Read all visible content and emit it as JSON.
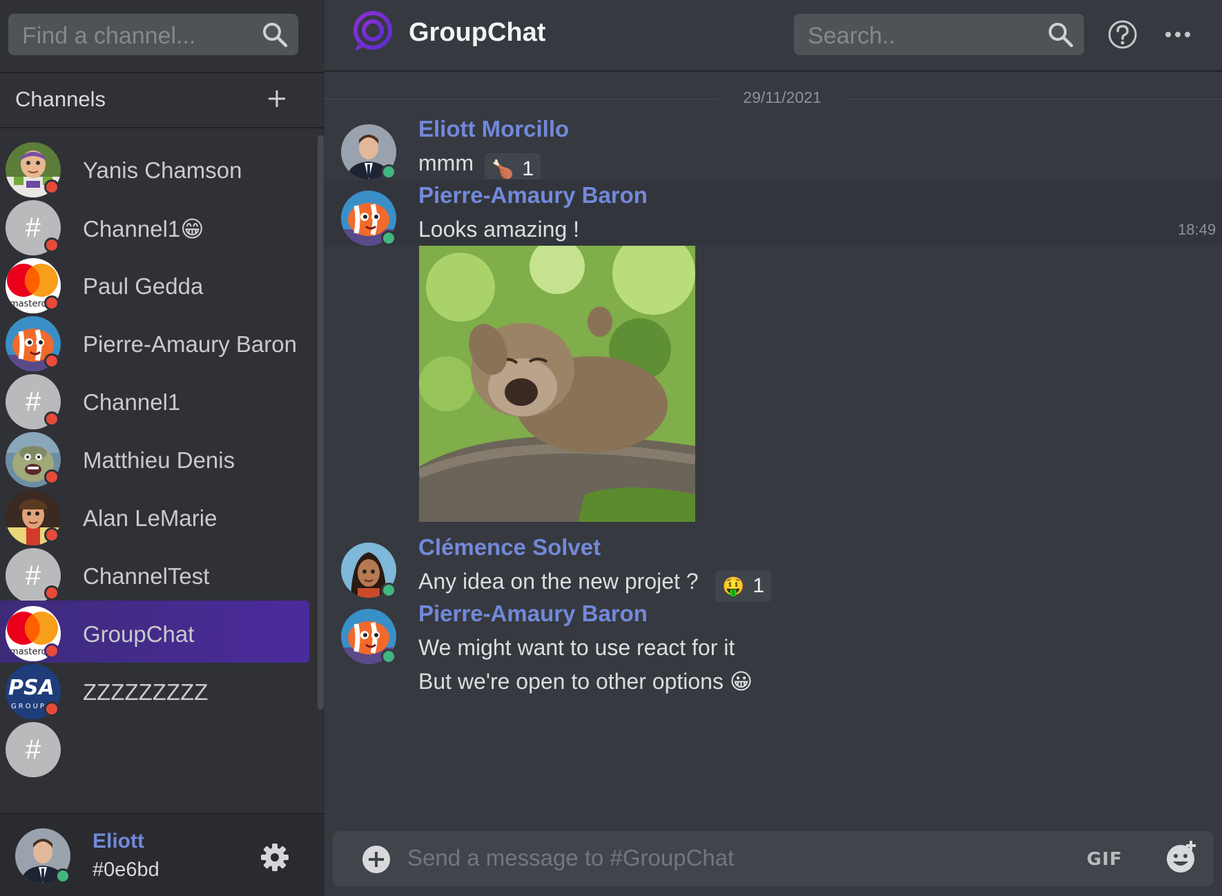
{
  "sidebar": {
    "search_placeholder": "Find a channel...",
    "channels_header": "Channels",
    "channels": [
      {
        "name": "Yanis Chamson",
        "avatar": "buzz-lightyear-avatar",
        "status": "offline"
      },
      {
        "name": "Channel1😁",
        "avatar": "hash",
        "status": "offline"
      },
      {
        "name": "Paul Gedda",
        "avatar": "mastercard-logo",
        "status": "offline"
      },
      {
        "name": "Pierre-Amaury Baron",
        "avatar": "clownfish-avatar",
        "status": "offline"
      },
      {
        "name": "Channel1",
        "avatar": "hash",
        "status": "offline"
      },
      {
        "name": "Matthieu Denis",
        "avatar": "roz-avatar",
        "status": "offline"
      },
      {
        "name": "Alan LeMarie",
        "avatar": "woody-avatar",
        "status": "offline"
      },
      {
        "name": "ChannelTest",
        "avatar": "hash",
        "status": "offline"
      },
      {
        "name": "GroupChat",
        "avatar": "mastercard-logo",
        "status": "offline",
        "active": true
      },
      {
        "name": "ZZZZZZZZZ",
        "avatar": "psa-group-logo",
        "status": "offline"
      },
      {
        "name": "",
        "avatar": "hash",
        "status": "offline"
      }
    ],
    "hash_symbol": "#",
    "mastercard_text": "mastercard",
    "psa_text": "PSA",
    "psa_subtext": "GROUP"
  },
  "user": {
    "name": "Eliott",
    "tag": "#0e6bd"
  },
  "header": {
    "title": "GroupChat",
    "search_placeholder": "Search.."
  },
  "chat": {
    "date": "29/11/2021",
    "messages": [
      {
        "author": "Eliott Morcillo",
        "text": "mmm",
        "reaction_emoji": "🍗",
        "reaction_count": "1"
      },
      {
        "author": "Pierre-Amaury Baron",
        "text": "Looks amazing !",
        "time": "18:49"
      },
      {
        "author": "Clémence Solvet",
        "text": "Any idea on the new projet ?",
        "reaction_emoji": "🤑",
        "reaction_count": "1"
      },
      {
        "author": "Pierre-Amaury Baron",
        "lines": [
          "We might want to use react for it",
          "But we're open to other options 😀"
        ]
      }
    ]
  },
  "composer": {
    "placeholder": "Send a message to #GroupChat",
    "gif_label": "GIF"
  },
  "colors": {
    "accent": "#7289da",
    "active_channel": "#4b2b9c",
    "status_offline": "#e84a3a",
    "status_online": "#43b581"
  }
}
